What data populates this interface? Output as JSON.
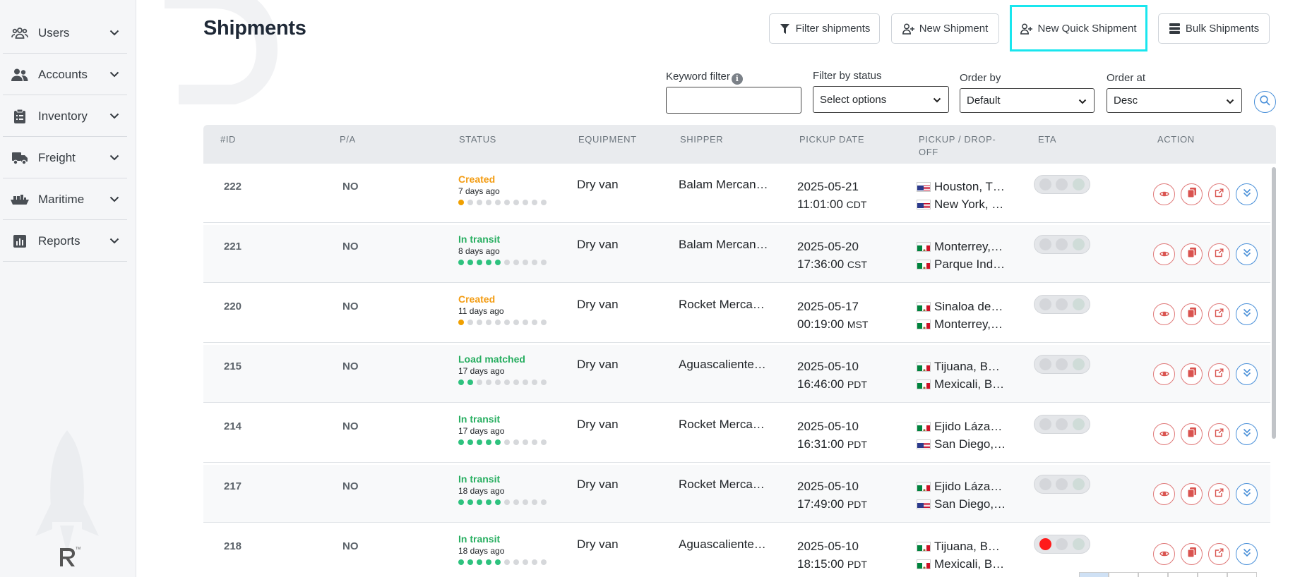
{
  "sidebar": {
    "items": [
      {
        "label": "Users",
        "icon": "users-group-icon"
      },
      {
        "label": "Accounts",
        "icon": "accounts-icon"
      },
      {
        "label": "Inventory",
        "icon": "clipboard-icon"
      },
      {
        "label": "Freight",
        "icon": "truck-icon"
      },
      {
        "label": "Maritime",
        "icon": "ship-icon"
      },
      {
        "label": "Reports",
        "icon": "chart-icon"
      }
    ]
  },
  "header": {
    "title": "Shipments",
    "buttons": {
      "filter": "Filter shipments",
      "new": "New Shipment",
      "quick": "New Quick Shipment",
      "bulk": "Bulk Shipments"
    }
  },
  "filters": {
    "keyword_label": "Keyword filter",
    "keyword_value": "",
    "status_label": "Filter by status",
    "status_value": "Select options",
    "order_by_label": "Order by",
    "order_by_value": "Default",
    "order_at_label": "Order at",
    "order_at_value": "Desc"
  },
  "table": {
    "columns": [
      "#ID",
      "P/A",
      "STATUS",
      "EQUIPMENT",
      "SHIPPER",
      "PICKUP DATE",
      "PICKUP / DROP-OFF",
      "ETA",
      "ACTION"
    ],
    "rows": [
      {
        "id": "222",
        "pa": "NO",
        "status": "Created",
        "status_color": "#f39c12",
        "ago": "7 days ago",
        "progress": 1,
        "equipment": "Dry van",
        "shipper": "Balam Mercan…",
        "date": "2025-05-21",
        "time": "11:01:00",
        "tz": "CDT",
        "pickup": "Houston, T…",
        "pickup_flag": "us",
        "dropoff": "New York, …",
        "dropoff_flag": "us",
        "eta_red": false
      },
      {
        "id": "221",
        "pa": "NO",
        "status": "In transit",
        "status_color": "#27ae60",
        "ago": "8 days ago",
        "progress": 5,
        "equipment": "Dry van",
        "shipper": "Balam Mercan…",
        "date": "2025-05-20",
        "time": "17:36:00",
        "tz": "CST",
        "pickup": "Monterrey,…",
        "pickup_flag": "mx",
        "dropoff": "Parque Ind…",
        "dropoff_flag": "mx",
        "eta_red": false
      },
      {
        "id": "220",
        "pa": "NO",
        "status": "Created",
        "status_color": "#f39c12",
        "ago": "11 days ago",
        "progress": 1,
        "equipment": "Dry van",
        "shipper": "Rocket Merca…",
        "date": "2025-05-17",
        "time": "00:19:00",
        "tz": "MST",
        "pickup": "Sinaloa de…",
        "pickup_flag": "mx",
        "dropoff": "Monterrey,…",
        "dropoff_flag": "mx",
        "eta_red": false
      },
      {
        "id": "215",
        "pa": "NO",
        "status": "Load matched",
        "status_color": "#27ae60",
        "ago": "17 days ago",
        "progress": 2,
        "equipment": "Dry van",
        "shipper": "Aguascaliente…",
        "date": "2025-05-10",
        "time": "16:46:00",
        "tz": "PDT",
        "pickup": "Tijuana, B…",
        "pickup_flag": "mx",
        "dropoff": "Mexicali, B…",
        "dropoff_flag": "mx",
        "eta_red": false
      },
      {
        "id": "214",
        "pa": "NO",
        "status": "In transit",
        "status_color": "#27ae60",
        "ago": "17 days ago",
        "progress": 5,
        "equipment": "Dry van",
        "shipper": "Rocket Merca…",
        "date": "2025-05-10",
        "time": "16:31:00",
        "tz": "PDT",
        "pickup": "Ejido Láza…",
        "pickup_flag": "mx",
        "dropoff": "San Diego,…",
        "dropoff_flag": "us",
        "eta_red": false
      },
      {
        "id": "217",
        "pa": "NO",
        "status": "In transit",
        "status_color": "#27ae60",
        "ago": "18 days ago",
        "progress": 5,
        "equipment": "Dry van",
        "shipper": "Rocket Merca…",
        "date": "2025-05-10",
        "time": "17:49:00",
        "tz": "PDT",
        "pickup": "Ejido Láza…",
        "pickup_flag": "mx",
        "dropoff": "San Diego,…",
        "dropoff_flag": "us",
        "eta_red": false
      },
      {
        "id": "218",
        "pa": "NO",
        "status": "In transit",
        "status_color": "#27ae60",
        "ago": "18 days ago",
        "progress": 5,
        "equipment": "Dry van",
        "shipper": "Aguascaliente…",
        "date": "2025-05-10",
        "time": "18:15:00",
        "tz": "PDT",
        "pickup": "Tijuana, B…",
        "pickup_flag": "mx",
        "dropoff": "Mexicali, B…",
        "dropoff_flag": "mx",
        "eta_red": true
      }
    ]
  }
}
